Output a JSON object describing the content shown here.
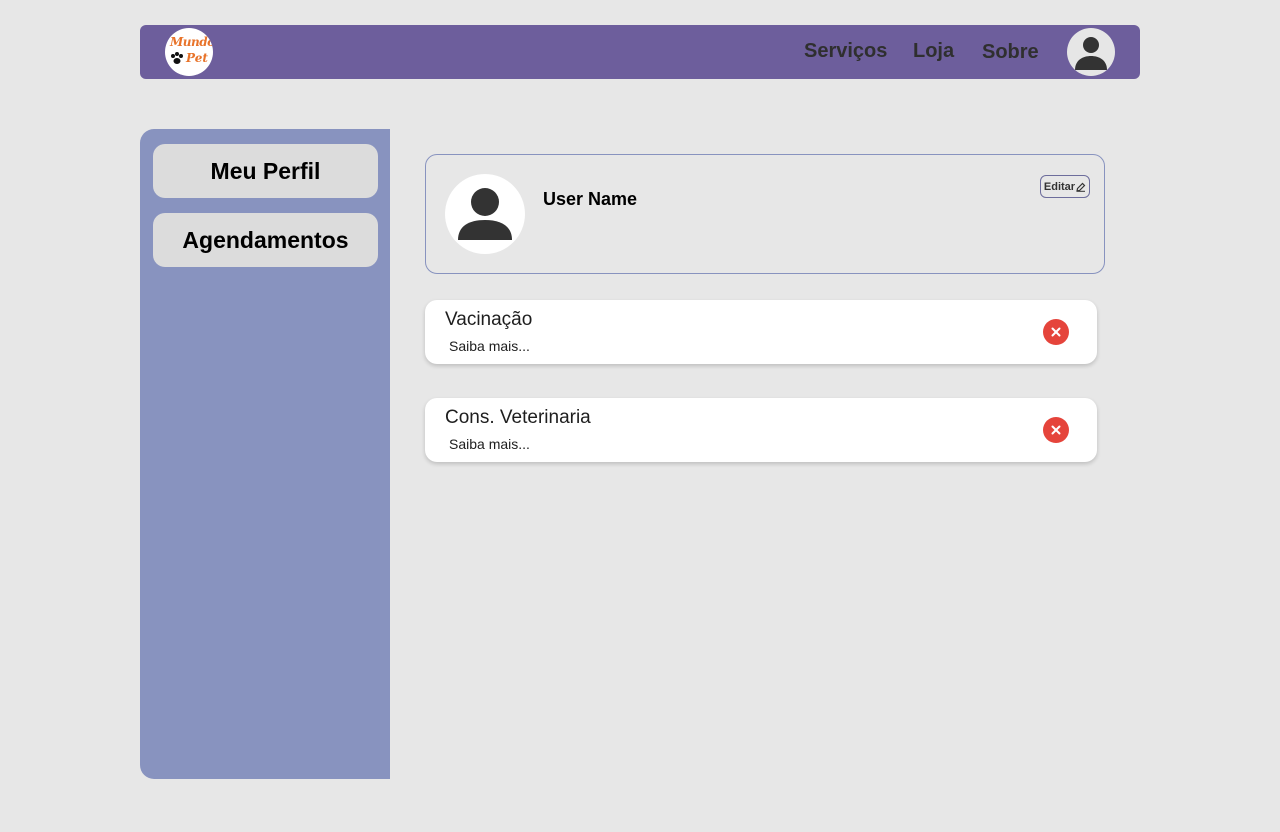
{
  "header": {
    "logo": {
      "line1": "Mundo",
      "line2": "Pet",
      "icon": "paw-print-icon"
    },
    "nav": {
      "servicos": "Serviços",
      "loja": "Loja",
      "sobre": "Sobre"
    },
    "user_icon": "user-avatar-icon"
  },
  "sidebar": {
    "items": [
      {
        "label": "Meu Perfil"
      },
      {
        "label": "Agendamentos"
      }
    ]
  },
  "profile": {
    "user_name": "User Name",
    "edit_label": "Editar",
    "edit_icon": "pencil-icon"
  },
  "appointments": [
    {
      "title": "Vacinação",
      "link": "Saiba mais..."
    },
    {
      "title": "Cons. Veterinaria",
      "link": "Saiba mais..."
    }
  ],
  "colors": {
    "header_bg": "#6d5e9c",
    "sidebar_bg": "#8893bf",
    "page_bg": "#e7e7e7",
    "delete_red": "#e5443b",
    "logo_orange": "#e8732a"
  }
}
